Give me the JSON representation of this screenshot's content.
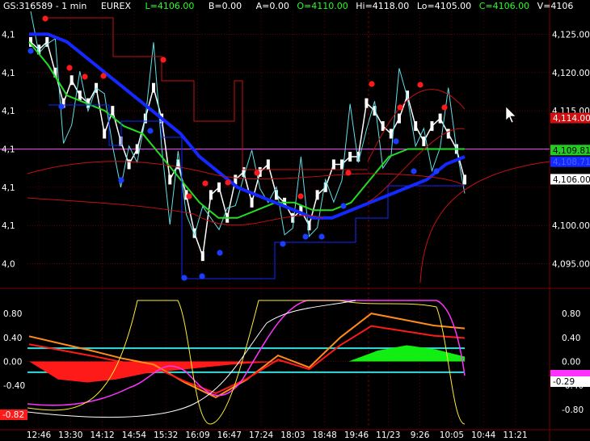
{
  "header": {
    "symbol": "GS:316589 - 1 min",
    "exchange": "EUREX",
    "last": "L=4106.00",
    "bid": "B=0.00",
    "ask": "A=0.00",
    "open": "O=4110.00",
    "high": "Hi=4118.00",
    "low": "Lo=4105.00",
    "close": "C=4106.00",
    "volume": "V=4106"
  },
  "price_axis": {
    "ticks": [
      "4,125.00",
      "4,120.00",
      "4,115.00",
      "4,100.00",
      "4,095.00"
    ],
    "left_ticks": [
      "4,1",
      "4,1",
      "4,1",
      "4,1",
      "4,1",
      "4,1",
      "4,0"
    ],
    "badges": [
      {
        "label": "4,114.00",
        "bg": "#d01010",
        "fg": "#ffffff"
      },
      {
        "label": "4,109.81",
        "bg": "#22cc22",
        "fg": "#000000"
      },
      {
        "label": "4,108.71",
        "bg": "#1428ff",
        "fg": "#4a66ff"
      },
      {
        "label": "4,106.00",
        "bg": "#ffffff",
        "fg": "#000000"
      }
    ]
  },
  "osc_axis": {
    "ticks": [
      "0.80",
      "0.40",
      "0.00",
      "-0.40",
      "-0.80"
    ],
    "left_ticks": [
      "0.80",
      "0.40",
      "0.00",
      "-0.40"
    ],
    "left_badge": "-0.82",
    "badges": [
      {
        "label": "",
        "bg": "#ff33ff",
        "fg": "#000000"
      },
      {
        "label": "-0.29",
        "bg": "#ffffff",
        "fg": "#000000"
      }
    ]
  },
  "time_axis": [
    "12:46",
    "13:30",
    "14:12",
    "14:54",
    "15:32",
    "16:09",
    "16:47",
    "17:24",
    "18:03",
    "18:48",
    "19:46",
    "11/23",
    "9:26",
    "10:05",
    "10:44",
    "11:21"
  ],
  "colors": {
    "background": "#000000",
    "grid": "#7a0000",
    "candles": "#ffffff",
    "cyan_line": "#5ee0e8",
    "blue_ma": "#1428ff",
    "green_ma": "#22dd22",
    "red_band": "#c41010",
    "magenta": "#ff33ff",
    "red_dot": "#ff1a1a",
    "blue_dot": "#1a3dff",
    "osc_red": "#ff1a1a",
    "osc_orange": "#ff8c1a",
    "osc_yellow": "#ffee33",
    "osc_green": "#11ee11",
    "osc_cyan": "#33dddd"
  },
  "cursor_icon": "mouse-pointer-icon",
  "chart_data": [
    {
      "type": "line",
      "title": "GS:316589 - 1 min",
      "ylim": [
        4092,
        4128
      ],
      "x_ticks": [
        "12:46",
        "13:30",
        "14:12",
        "14:54",
        "15:32",
        "16:09",
        "16:47",
        "17:24",
        "18:03",
        "18:48",
        "19:46",
        "11/23",
        "9:26",
        "10:05"
      ],
      "price_bars": [
        4124,
        4123,
        4124,
        4120,
        4116,
        4119,
        4117,
        4116,
        4118,
        4112,
        4115,
        4111,
        4108,
        4110,
        4114,
        4118,
        4114,
        4106,
        4108,
        4104,
        4099,
        4096,
        4104,
        4105,
        4101,
        4106,
        4107,
        4103,
        4107,
        4108,
        4104,
        4103,
        4101,
        4102,
        4100,
        4104,
        4105,
        4108,
        4108,
        4109,
        4109,
        4116,
        4115,
        4113,
        4112,
        4114,
        4117,
        4113,
        4111,
        4113,
        4114,
        4112,
        4110,
        4106
      ],
      "series": [
        {
          "name": "Blue MA",
          "values": [
            4125,
            4125,
            4124,
            4122,
            4120,
            4118,
            4116,
            4114,
            4112,
            4109,
            4107,
            4105,
            4104,
            4103,
            4102,
            4101,
            4101,
            4102,
            4103,
            4104,
            4105,
            4106,
            4108,
            4109
          ]
        },
        {
          "name": "Green MA",
          "values": [
            4124,
            4121,
            4117,
            4116,
            4115,
            4113,
            4112,
            4109,
            4106,
            4103,
            4101,
            4101,
            4102,
            4103,
            4103,
            4102,
            4102,
            4103,
            4106,
            4109,
            4110,
            4110,
            4110,
            4110
          ]
        }
      ],
      "price_labels": [
        "4,114.00",
        "4,109.81",
        "4,108.71",
        "4,106.00"
      ]
    },
    {
      "type": "area",
      "ylim": [
        -1,
        1
      ],
      "reference_lines": [
        0.22,
        -0.18
      ],
      "series": [
        {
          "name": "Histogram",
          "values": [
            0,
            -0.3,
            -0.35,
            -0.3,
            -0.2,
            -0.15,
            -0.1,
            -0.05,
            -0.02,
            0,
            0,
            0,
            0.18,
            0.27,
            0.2,
            0.08
          ]
        },
        {
          "name": "Oscillator",
          "values": [
            0.42,
            0.3,
            0.18,
            0.05,
            -0.05,
            -0.35,
            -0.6,
            -0.3,
            0.1,
            -0.1,
            0.4,
            0.8,
            0.7,
            0.6,
            0.55
          ]
        }
      ],
      "labels": [
        "-0.82",
        "-0.29"
      ]
    }
  ]
}
